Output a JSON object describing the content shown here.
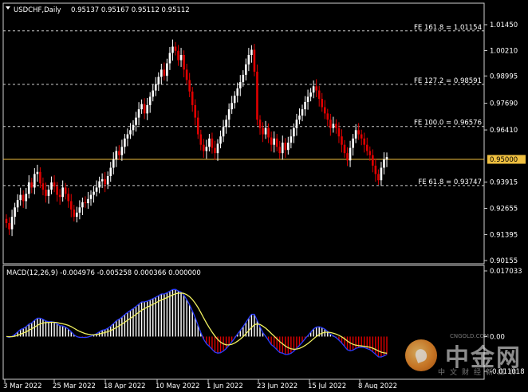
{
  "header": {
    "symbol": "USDCHF,Daily",
    "ohlc": "0.95137 0.95167 0.95112 0.95112",
    "menu_icon": "triangle-down-icon"
  },
  "price_axis": {
    "labels": [
      "1.01450",
      "1.00210",
      "0.98995",
      "0.97690",
      "0.96410",
      "0.95000",
      "0.93915",
      "0.92655",
      "0.91395",
      "0.90155"
    ],
    "values": [
      1.0145,
      1.0021,
      0.98995,
      0.9769,
      0.9641,
      0.95,
      0.93915,
      0.92655,
      0.91395,
      0.90155
    ],
    "current_price": "0.95000",
    "current_color": "#f0c040"
  },
  "fib_levels": [
    {
      "label": "FE 161.8 = 1.01154",
      "value": 1.01154
    },
    {
      "label": "FE 127.2 = 0.98591",
      "value": 0.98591
    },
    {
      "label": "FE 100.0 = 0.96576",
      "value": 0.96576
    },
    {
      "label": "FE 61.8 = 0.93747",
      "value": 0.93747
    }
  ],
  "macd": {
    "title": "MACD(12,26,9) -0.004976 -0.005258 0.000366 0.000000",
    "axis_labels": [
      "0.017033",
      "0.00",
      "-0.011018"
    ],
    "axis_values": [
      0.017033,
      0.0,
      -0.011018
    ]
  },
  "x_axis": {
    "labels": [
      "3 Mar 2022",
      "25 Mar 2022",
      "18 Apr 2022",
      "10 May 2022",
      "1 Jun 2022",
      "23 Jun 2022",
      "15 Jul 2022",
      "8 Aug 2022"
    ]
  },
  "watermark": {
    "brand": "中金网",
    "url": "CNGOLD.COM",
    "sub": "中文财经新媒体"
  },
  "colors": {
    "bull": "#ffffff",
    "bear": "#e00000",
    "signal": "#f0f060",
    "macd_line": "#2a3cff",
    "hist_pos": "#ffffff",
    "hist_neg": "#e00000",
    "grid": "#cfcfcf"
  },
  "chart_data": {
    "type": "candlestick",
    "series_close": [
      0.9195,
      0.9165,
      0.9225,
      0.927,
      0.9305,
      0.933,
      0.93,
      0.9335,
      0.939,
      0.9365,
      0.943,
      0.944,
      0.9385,
      0.9355,
      0.9325,
      0.9355,
      0.939,
      0.937,
      0.933,
      0.932,
      0.9365,
      0.9335,
      0.93,
      0.926,
      0.9225,
      0.9245,
      0.927,
      0.9295,
      0.929,
      0.931,
      0.933,
      0.9345,
      0.9365,
      0.9395,
      0.9405,
      0.938,
      0.942,
      0.946,
      0.95,
      0.954,
      0.952,
      0.956,
      0.96,
      0.962,
      0.964,
      0.9665,
      0.97,
      0.974,
      0.9765,
      0.972,
      0.976,
      0.98,
      0.983,
      0.986,
      0.9895,
      0.993,
      0.99,
      0.996,
      1.001,
      1.004,
      1.002,
      0.9975,
      1.0,
      0.993,
      0.988,
      0.9825,
      0.976,
      0.97,
      0.962,
      0.957,
      0.954,
      0.956,
      0.96,
      0.9555,
      0.953,
      0.9575,
      0.961,
      0.9655,
      0.969,
      0.974,
      0.977,
      0.9805,
      0.984,
      0.987,
      0.9905,
      0.9955,
      1.0,
      1.0025,
      0.992,
      0.969,
      0.965,
      0.962,
      0.965,
      0.9605,
      0.957,
      0.96,
      0.956,
      0.953,
      0.958,
      0.9545,
      0.958,
      0.961,
      0.965,
      0.969,
      0.971,
      0.974,
      0.9775,
      0.98,
      0.982,
      0.985,
      0.983,
      0.979,
      0.975,
      0.972,
      0.969,
      0.965,
      0.967,
      0.965,
      0.961,
      0.957,
      0.953,
      0.9495,
      0.9555,
      0.96,
      0.964,
      0.962,
      0.96,
      0.957,
      0.954,
      0.952,
      0.947,
      0.943,
      0.94,
      0.946,
      0.95,
      0.9511
    ],
    "x_tick_labels": [
      "3 Mar 2022",
      "25 Mar 2022",
      "18 Apr 2022",
      "10 May 2022",
      "1 Jun 2022",
      "23 Jun 2022",
      "15 Jul 2022",
      "8 Aug 2022"
    ],
    "ylim": [
      0.90155,
      1.0145
    ]
  }
}
